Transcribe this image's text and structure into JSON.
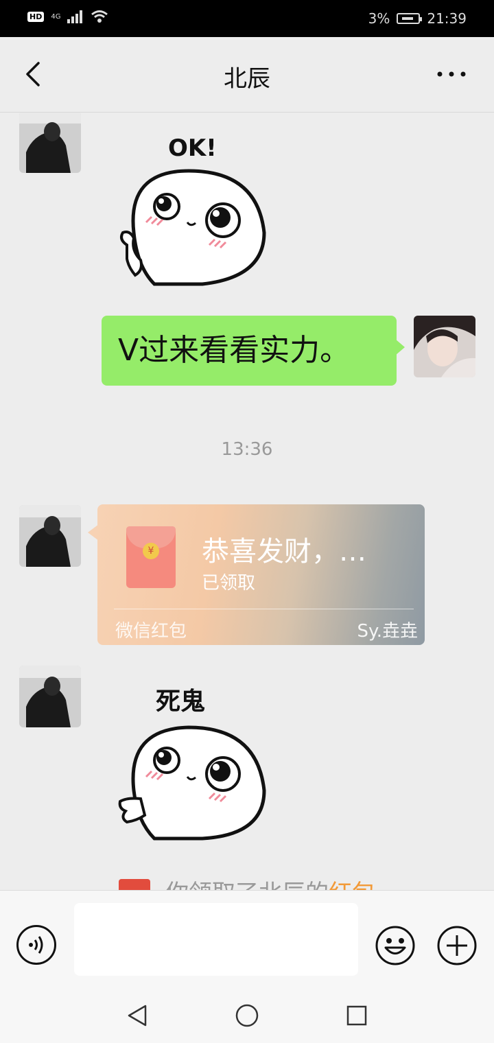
{
  "status_bar": {
    "network": "4G",
    "hd_label": "HD",
    "battery": "3%",
    "time": "21:39"
  },
  "header": {
    "title": "北辰",
    "back_icon": "chevron-left-icon",
    "more_icon": "more-dots-icon"
  },
  "messages": [
    {
      "type": "sticker",
      "from": "other",
      "caption": "OK!"
    },
    {
      "type": "text",
      "from": "me",
      "text": "V过来看看实力。"
    },
    {
      "type": "time",
      "text": "13:36"
    },
    {
      "type": "red_packet",
      "from": "other",
      "title": "恭喜发财，…",
      "status": "已领取",
      "footer_left": "微信红包",
      "footer_right": "Sy.垚垚"
    },
    {
      "type": "sticker",
      "from": "other",
      "caption": "死鬼"
    },
    {
      "type": "system",
      "prefix": "你领取了北辰的",
      "highlight": "红包"
    }
  ],
  "input_bar": {
    "value": "",
    "voice_icon": "voice-icon",
    "emoji_icon": "emoji-icon",
    "plus_icon": "plus-icon"
  },
  "system_nav": {
    "back_icon": "nav-back-icon",
    "home_icon": "nav-home-icon",
    "recent_icon": "nav-recent-icon"
  },
  "colors": {
    "bubble_me": "#95ec69",
    "background": "#ededed",
    "red_packet_highlight": "#f29a38"
  }
}
